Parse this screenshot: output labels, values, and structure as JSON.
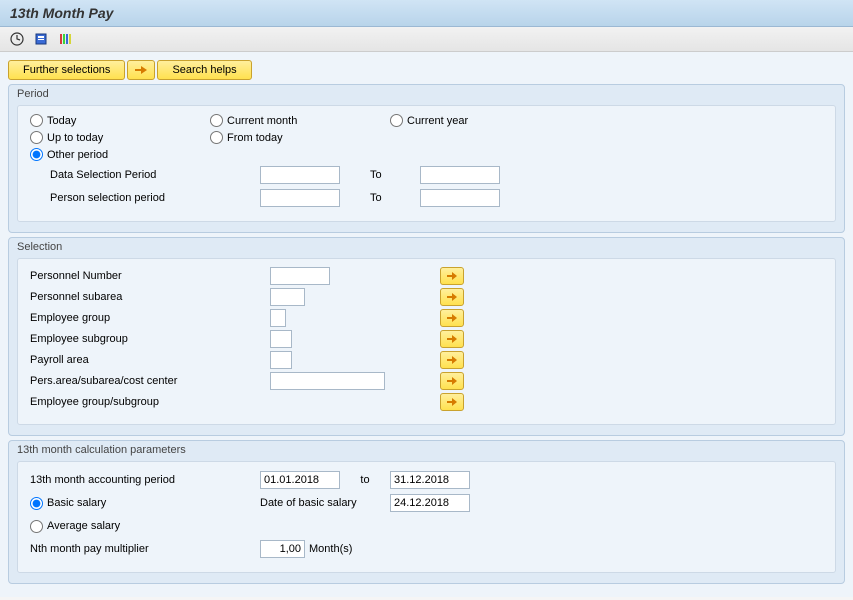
{
  "title": "13th Month Pay",
  "toolbar": {
    "further_selections": "Further selections",
    "search_helps": "Search helps"
  },
  "period": {
    "title": "Period",
    "today": "Today",
    "current_month": "Current month",
    "current_year": "Current year",
    "up_to_today": "Up to today",
    "from_today": "From today",
    "other_period": "Other period",
    "data_selection": "Data Selection Period",
    "person_selection": "Person selection period",
    "to": "To",
    "selected": "other_period",
    "data_from": "",
    "data_to": "",
    "person_from": "",
    "person_to": ""
  },
  "selection": {
    "title": "Selection",
    "personnel_number": "Personnel Number",
    "personnel_subarea": "Personnel subarea",
    "employee_group": "Employee group",
    "employee_subgroup": "Employee subgroup",
    "payroll_area": "Payroll area",
    "pers_area": "Pers.area/subarea/cost center",
    "employee_group_subgroup": "Employee group/subgroup",
    "values": {
      "personnel_number": "",
      "personnel_subarea": "",
      "employee_group": "",
      "employee_subgroup": "",
      "payroll_area": "",
      "pers_area": "",
      "employee_group_subgroup": ""
    }
  },
  "calc": {
    "title": "13th month calculation parameters",
    "accounting_period": "13th month accounting period",
    "basic_salary": "Basic salary",
    "date_of_basic_salary": "Date of basic salary",
    "average_salary": "Average salary",
    "nth_multiplier": "Nth month pay multiplier",
    "months_unit": "Month(s)",
    "to": "to",
    "selected": "basic_salary",
    "values": {
      "period_from": "01.01.2018",
      "period_to": "31.12.2018",
      "basic_salary_date": "24.12.2018",
      "multiplier": "1,00"
    }
  }
}
